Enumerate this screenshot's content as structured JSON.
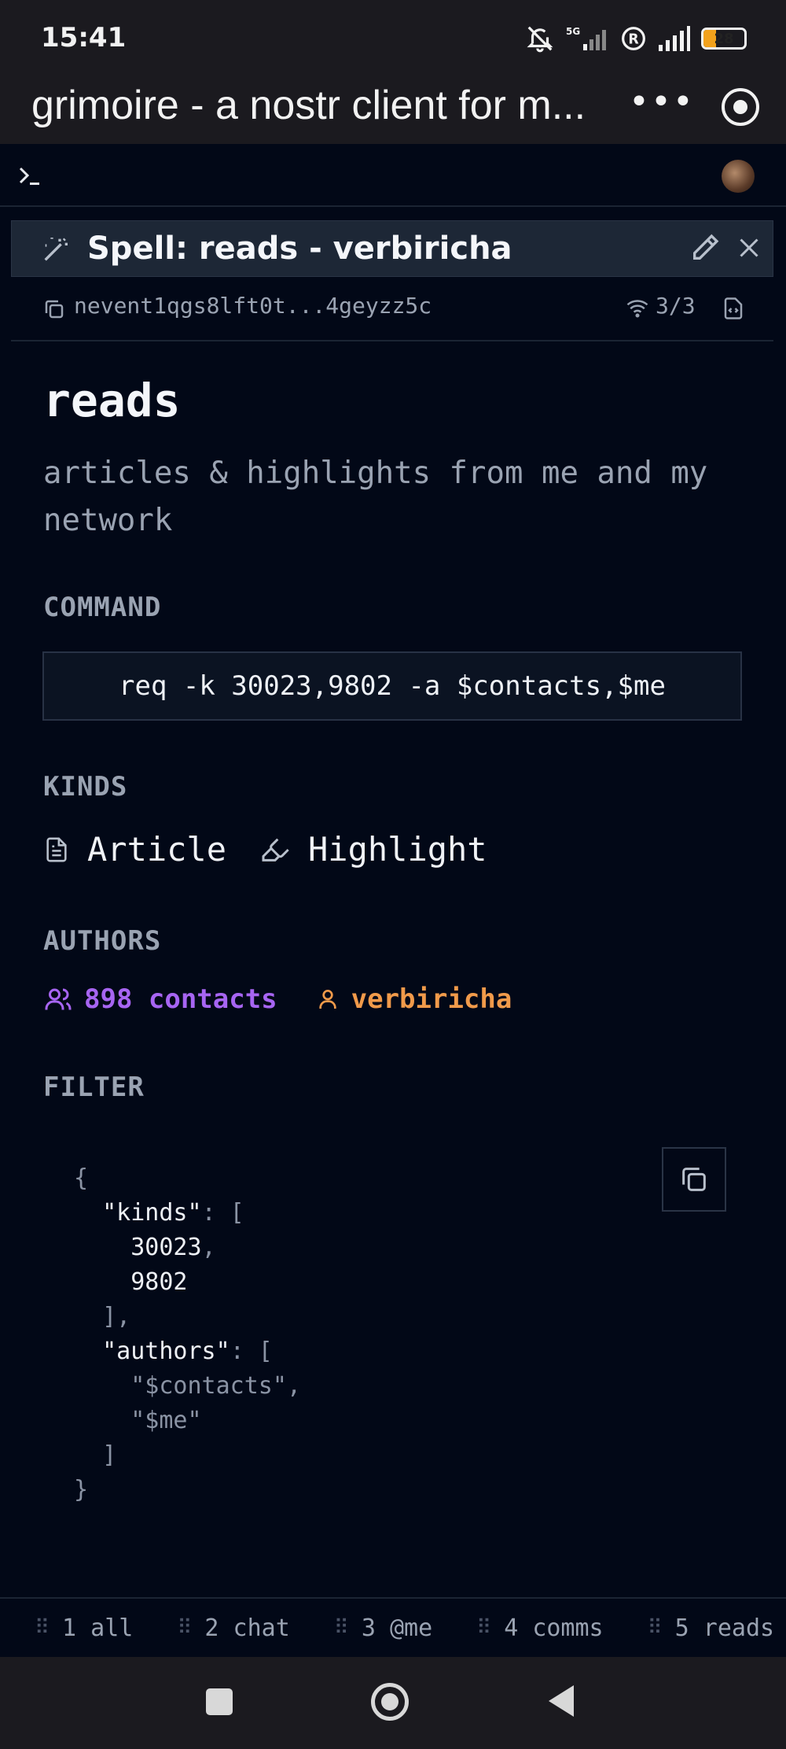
{
  "status_bar": {
    "time": "15:41",
    "battery_level": "28",
    "network": "5G"
  },
  "browser": {
    "title": "grimoire - a nostr client for m...",
    "more_label": "•••"
  },
  "window": {
    "title": "Spell: reads - verbiricha",
    "event_id": "nevent1qgs8lft0t...4geyzz5c",
    "relay_count": "3/3"
  },
  "spell": {
    "name": "reads",
    "description": "articles & highlights from me and my network"
  },
  "sections": {
    "command": "COMMAND",
    "kinds": "KINDS",
    "authors": "AUTHORS",
    "filter": "FILTER"
  },
  "command": "req -k 30023,9802 -a $contacts,$me",
  "kinds": [
    {
      "label": "Article",
      "icon": "document-icon"
    },
    {
      "label": "Highlight",
      "icon": "highlighter-icon"
    }
  ],
  "authors": [
    {
      "label": "898 contacts",
      "icon": "users-icon",
      "color": "#a765f2"
    },
    {
      "label": "verbiricha",
      "icon": "user-icon",
      "color": "#f19a4a"
    }
  ],
  "filter": {
    "kinds": [
      "30023",
      "9802"
    ],
    "authors": [
      "\"$contacts\"",
      "\"$me\""
    ]
  },
  "tabs": [
    {
      "num": "1",
      "label": "all"
    },
    {
      "num": "2",
      "label": "chat"
    },
    {
      "num": "3",
      "label": "@me"
    },
    {
      "num": "4",
      "label": "comms"
    },
    {
      "num": "5",
      "label": "reads"
    }
  ],
  "colors": {
    "background": "#020817",
    "accent_purple": "#a765f2",
    "accent_orange": "#f19a4a"
  }
}
